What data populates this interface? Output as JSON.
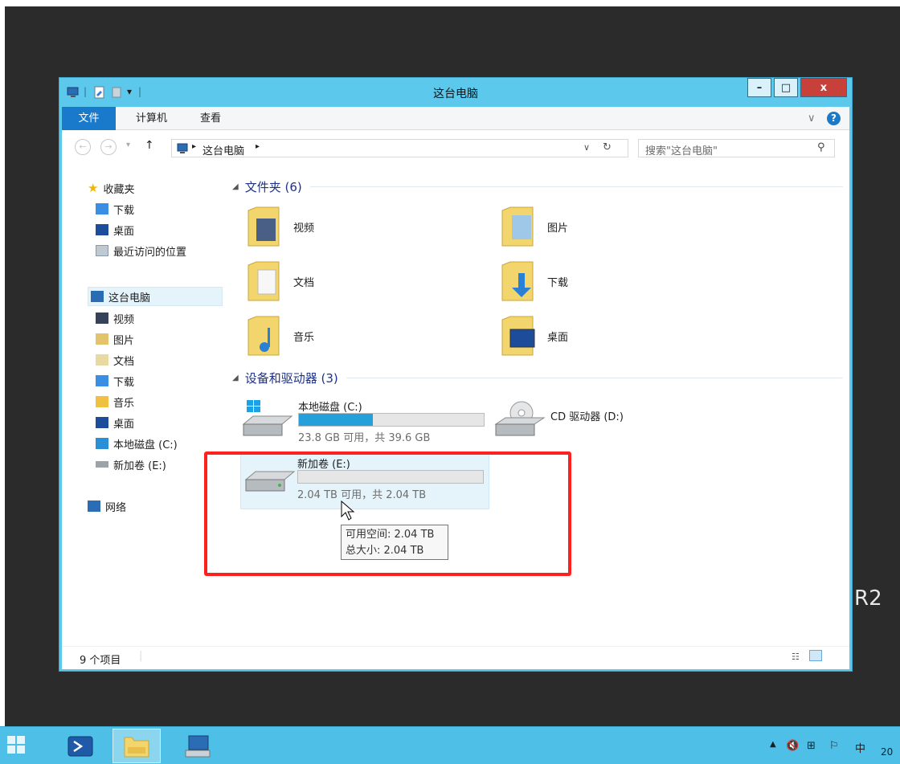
{
  "desktop": {
    "corner_text": "R2"
  },
  "window": {
    "title": "这台电脑",
    "buttons": {
      "minimize": "–",
      "maximize": "□",
      "close": "x"
    }
  },
  "ribbon": {
    "tabs": [
      {
        "label": "文件"
      },
      {
        "label": "计算机"
      },
      {
        "label": "查看"
      }
    ],
    "help_icon": "?",
    "expand_icon": "∨"
  },
  "address": {
    "path_items": [
      "这台电脑"
    ],
    "search_placeholder": "搜索\"这台电脑\""
  },
  "nav": {
    "favorites_label": "收藏夹",
    "favorites": [
      "下载",
      "桌面",
      "最近访问的位置"
    ],
    "thispc_label": "这台电脑",
    "thispc_items": [
      "视频",
      "图片",
      "文档",
      "下载",
      "音乐",
      "桌面",
      "本地磁盘 (C:)",
      "新加卷 (E:)"
    ],
    "network_label": "网络"
  },
  "main": {
    "folders_header": "文件夹 (6)",
    "folders": [
      "视频",
      "图片",
      "文档",
      "下载",
      "音乐",
      "桌面"
    ],
    "devices_header": "设备和驱动器 (3)",
    "drives": [
      {
        "name": "本地磁盘 (C:)",
        "free_text": "23.8 GB 可用，共 39.6 GB",
        "used_fraction": 0.4
      },
      {
        "name": "CD 驱动器 (D:)"
      },
      {
        "name": "新加卷 (E:)",
        "free_text": "2.04 TB 可用，共 2.04 TB",
        "used_fraction": 0.0
      }
    ],
    "tooltip": {
      "line1": "可用空间: 2.04 TB",
      "line2": "总大小: 2.04 TB"
    }
  },
  "status": {
    "count": "9 个项目"
  },
  "taskbar": {
    "tray_ime": "中",
    "clock_fragment": "20"
  },
  "colors": {
    "accent": "#1979ca",
    "titlebar": "#5cc9ec",
    "close": "#c7403a",
    "highlight": "#ff2020"
  }
}
